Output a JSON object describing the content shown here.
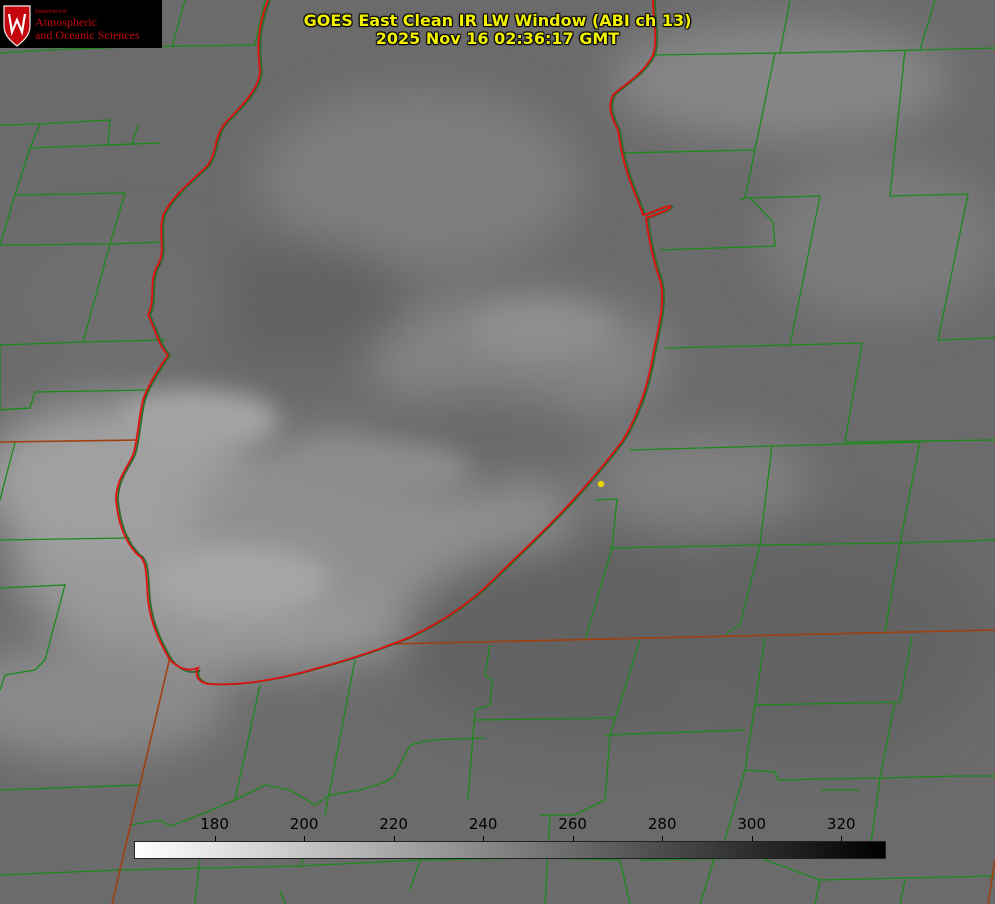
{
  "title": {
    "line1": "GOES East Clean IR LW Window (ABI ch 13)",
    "line2": "2025 Nov 16 02:36:17 GMT"
  },
  "logo": {
    "department": "Department of",
    "line1": "Atmospheric",
    "line2": "and Oceanic Sciences",
    "icon": "uw-crest-icon",
    "accent_color": "#c5050c"
  },
  "colorbar": {
    "ticks": [
      "180",
      "200",
      "220",
      "240",
      "260",
      "280",
      "300",
      "320"
    ],
    "range": [
      162,
      330
    ],
    "colormap": "white (cold) to black (warm)"
  },
  "colors": {
    "county_lines": "#1a8a1a",
    "state_lines": "#a04010",
    "lake_outline": "#e01010",
    "title_text": "#f2f200",
    "marker": "#e6d200"
  },
  "features": {
    "lake": "Lake Michigan outline",
    "marker": "yellow point marker"
  }
}
